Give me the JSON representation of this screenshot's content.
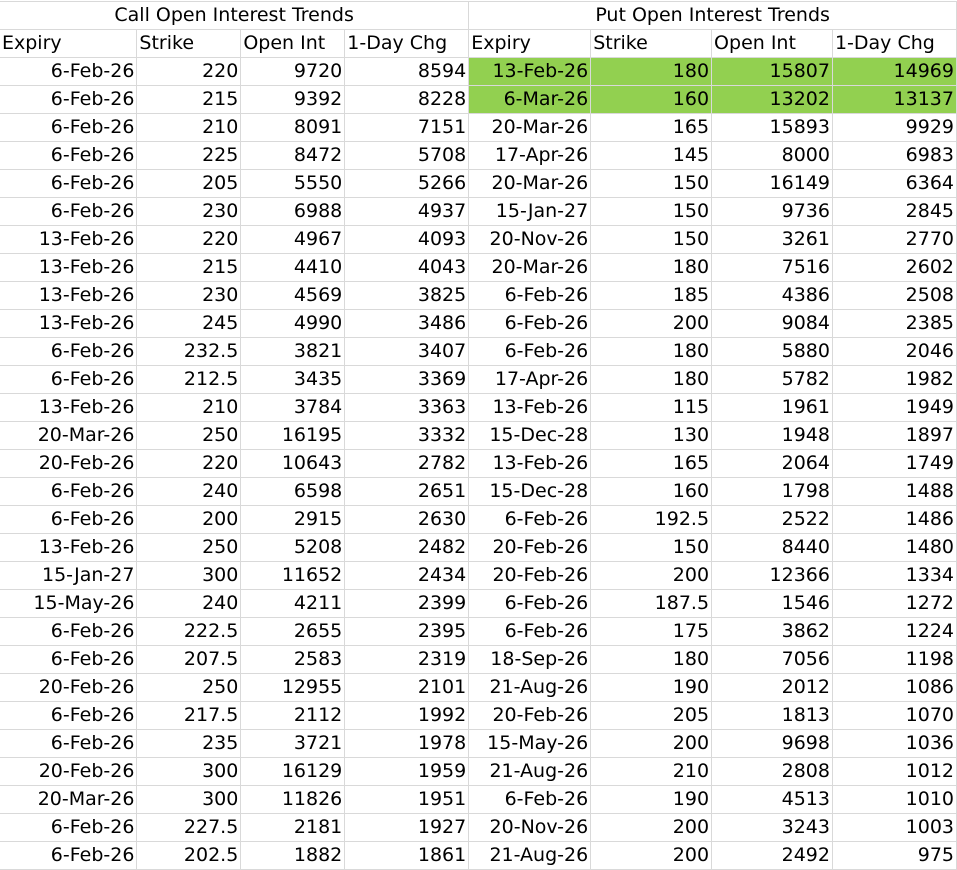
{
  "titles": {
    "call": "Call Open Interest Trends",
    "put": "Put Open Interest Trends"
  },
  "headers": {
    "call": [
      "Expiry",
      "Strike",
      "Open Int",
      "1-Day Chg"
    ],
    "put": [
      "Expiry",
      "Strike",
      "Open Int",
      "1-Day Chg"
    ]
  },
  "highlight_color": "#92d050",
  "highlighted_put_rows": [
    0,
    1
  ],
  "rows": [
    {
      "call": [
        "6-Feb-26",
        "220",
        "9720",
        "8594"
      ],
      "put": [
        "13-Feb-26",
        "180",
        "15807",
        "14969"
      ]
    },
    {
      "call": [
        "6-Feb-26",
        "215",
        "9392",
        "8228"
      ],
      "put": [
        "6-Mar-26",
        "160",
        "13202",
        "13137"
      ]
    },
    {
      "call": [
        "6-Feb-26",
        "210",
        "8091",
        "7151"
      ],
      "put": [
        "20-Mar-26",
        "165",
        "15893",
        "9929"
      ]
    },
    {
      "call": [
        "6-Feb-26",
        "225",
        "8472",
        "5708"
      ],
      "put": [
        "17-Apr-26",
        "145",
        "8000",
        "6983"
      ]
    },
    {
      "call": [
        "6-Feb-26",
        "205",
        "5550",
        "5266"
      ],
      "put": [
        "20-Mar-26",
        "150",
        "16149",
        "6364"
      ]
    },
    {
      "call": [
        "6-Feb-26",
        "230",
        "6988",
        "4937"
      ],
      "put": [
        "15-Jan-27",
        "150",
        "9736",
        "2845"
      ]
    },
    {
      "call": [
        "13-Feb-26",
        "220",
        "4967",
        "4093"
      ],
      "put": [
        "20-Nov-26",
        "150",
        "3261",
        "2770"
      ]
    },
    {
      "call": [
        "13-Feb-26",
        "215",
        "4410",
        "4043"
      ],
      "put": [
        "20-Mar-26",
        "180",
        "7516",
        "2602"
      ]
    },
    {
      "call": [
        "13-Feb-26",
        "230",
        "4569",
        "3825"
      ],
      "put": [
        "6-Feb-26",
        "185",
        "4386",
        "2508"
      ]
    },
    {
      "call": [
        "13-Feb-26",
        "245",
        "4990",
        "3486"
      ],
      "put": [
        "6-Feb-26",
        "200",
        "9084",
        "2385"
      ]
    },
    {
      "call": [
        "6-Feb-26",
        "232.5",
        "3821",
        "3407"
      ],
      "put": [
        "6-Feb-26",
        "180",
        "5880",
        "2046"
      ]
    },
    {
      "call": [
        "6-Feb-26",
        "212.5",
        "3435",
        "3369"
      ],
      "put": [
        "17-Apr-26",
        "180",
        "5782",
        "1982"
      ]
    },
    {
      "call": [
        "13-Feb-26",
        "210",
        "3784",
        "3363"
      ],
      "put": [
        "13-Feb-26",
        "115",
        "1961",
        "1949"
      ]
    },
    {
      "call": [
        "20-Mar-26",
        "250",
        "16195",
        "3332"
      ],
      "put": [
        "15-Dec-28",
        "130",
        "1948",
        "1897"
      ]
    },
    {
      "call": [
        "20-Feb-26",
        "220",
        "10643",
        "2782"
      ],
      "put": [
        "13-Feb-26",
        "165",
        "2064",
        "1749"
      ]
    },
    {
      "call": [
        "6-Feb-26",
        "240",
        "6598",
        "2651"
      ],
      "put": [
        "15-Dec-28",
        "160",
        "1798",
        "1488"
      ]
    },
    {
      "call": [
        "6-Feb-26",
        "200",
        "2915",
        "2630"
      ],
      "put": [
        "6-Feb-26",
        "192.5",
        "2522",
        "1486"
      ]
    },
    {
      "call": [
        "13-Feb-26",
        "250",
        "5208",
        "2482"
      ],
      "put": [
        "20-Feb-26",
        "150",
        "8440",
        "1480"
      ]
    },
    {
      "call": [
        "15-Jan-27",
        "300",
        "11652",
        "2434"
      ],
      "put": [
        "20-Feb-26",
        "200",
        "12366",
        "1334"
      ]
    },
    {
      "call": [
        "15-May-26",
        "240",
        "4211",
        "2399"
      ],
      "put": [
        "6-Feb-26",
        "187.5",
        "1546",
        "1272"
      ]
    },
    {
      "call": [
        "6-Feb-26",
        "222.5",
        "2655",
        "2395"
      ],
      "put": [
        "6-Feb-26",
        "175",
        "3862",
        "1224"
      ]
    },
    {
      "call": [
        "6-Feb-26",
        "207.5",
        "2583",
        "2319"
      ],
      "put": [
        "18-Sep-26",
        "180",
        "7056",
        "1198"
      ]
    },
    {
      "call": [
        "20-Feb-26",
        "250",
        "12955",
        "2101"
      ],
      "put": [
        "21-Aug-26",
        "190",
        "2012",
        "1086"
      ]
    },
    {
      "call": [
        "6-Feb-26",
        "217.5",
        "2112",
        "1992"
      ],
      "put": [
        "20-Feb-26",
        "205",
        "1813",
        "1070"
      ]
    },
    {
      "call": [
        "6-Feb-26",
        "235",
        "3721",
        "1978"
      ],
      "put": [
        "15-May-26",
        "200",
        "9698",
        "1036"
      ]
    },
    {
      "call": [
        "20-Feb-26",
        "300",
        "16129",
        "1959"
      ],
      "put": [
        "21-Aug-26",
        "210",
        "2808",
        "1012"
      ]
    },
    {
      "call": [
        "20-Mar-26",
        "300",
        "11826",
        "1951"
      ],
      "put": [
        "6-Feb-26",
        "190",
        "4513",
        "1010"
      ]
    },
    {
      "call": [
        "6-Feb-26",
        "227.5",
        "2181",
        "1927"
      ],
      "put": [
        "20-Nov-26",
        "200",
        "3243",
        "1003"
      ]
    },
    {
      "call": [
        "6-Feb-26",
        "202.5",
        "1882",
        "1861"
      ],
      "put": [
        "21-Aug-26",
        "200",
        "2492",
        "975"
      ]
    }
  ]
}
